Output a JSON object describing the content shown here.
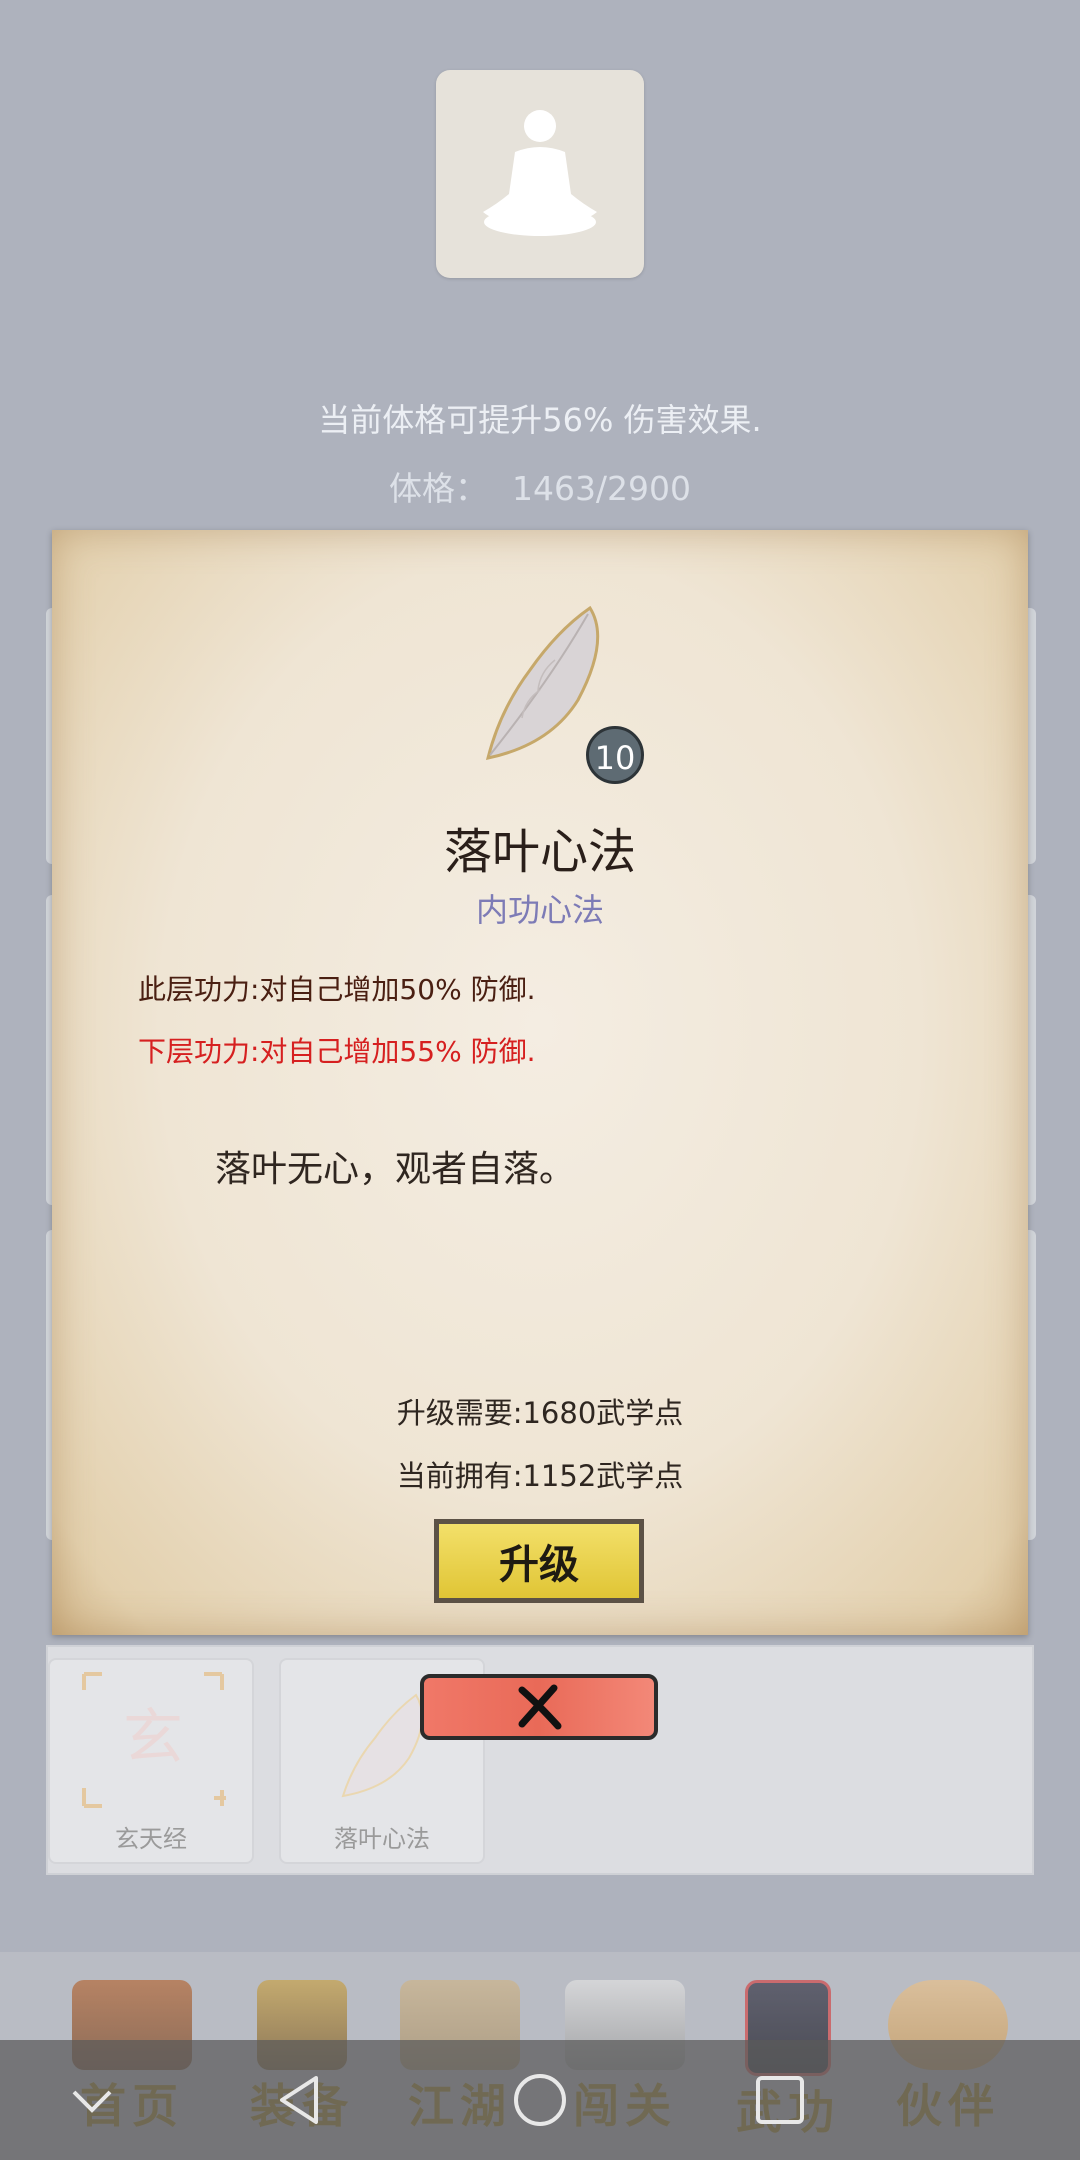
{
  "header": {
    "stat_description": "当前体格可提升56% 伤害效果.",
    "constitution_label": "体格：",
    "constitution_value": "1463/2900"
  },
  "skill_dialog": {
    "level": "10",
    "title": "落叶心法",
    "category": "内功心法",
    "current_effect": "此层功力:对自己增加50% 防御.",
    "next_effect": "下层功力:对自己增加55% 防御.",
    "quote": "落叶无心，观者自落。",
    "upgrade_cost": "升级需要:1680武学点",
    "current_points": "当前拥有:1152武学点",
    "upgrade_button": "升级",
    "close_icon": "close-x-icon"
  },
  "skill_cards": [
    {
      "label": "玄天经",
      "icon": "xuan-scroll-icon"
    },
    {
      "label": "落叶心法",
      "icon": "leaf-icon"
    }
  ],
  "bottom_nav": [
    {
      "label": "首页",
      "icon": "house-icon"
    },
    {
      "label": "装备",
      "icon": "armor-icon"
    },
    {
      "label": "江湖",
      "icon": "map-scroll-icon"
    },
    {
      "label": "闯关",
      "icon": "crossed-swords-icon"
    },
    {
      "label": "武功",
      "icon": "book-icon"
    },
    {
      "label": "伙伴",
      "icon": "partners-icon"
    }
  ],
  "system_nav": {
    "icons": [
      "chevron-down-icon",
      "back-triangle-icon",
      "home-circle-icon",
      "recents-square-icon"
    ]
  },
  "colors": {
    "next_effect": "#d62020",
    "category": "#7d7bb6",
    "upgrade_button": "#f3e06a",
    "close_button": "#ec6f5e",
    "nav_label": "#a88a2a"
  }
}
